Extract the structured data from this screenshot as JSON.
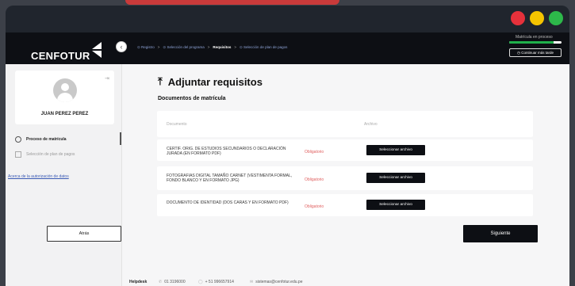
{
  "window": {
    "colors": {
      "close": "#e6313b",
      "minimize": "#f5c400",
      "maximize": "#2db84a",
      "accent": "#20b04b",
      "required": "#e06060"
    }
  },
  "sidebar": {
    "logo": "CENFOTUR",
    "collapse_icon": "chevron-left-icon",
    "user_name": "JUAN PEREZ PEREZ",
    "items": [
      {
        "label": "Proceso de matrícula",
        "icon": "circle-icon"
      },
      {
        "label": "Selección de plan de pagos",
        "icon": "calendar-icon"
      }
    ],
    "link": "Acerca de la autorización de datos"
  },
  "header": {
    "breadcrumb": [
      {
        "label": "⊙ Registro"
      },
      {
        "label": "⊙ Selección del programa"
      },
      {
        "label": "Requisitos"
      },
      {
        "label": "⊙ Selección de plan de pagos"
      }
    ],
    "progress_label": "Matrícula en proceso",
    "progress_value": 0.85,
    "continue_label": "Continuar más tarde"
  },
  "main": {
    "title": "Adjuntar requisitos",
    "section_title": "Documentos de matrícula",
    "table": {
      "columns": [
        "Documento",
        "Archivo"
      ],
      "rows": [
        {
          "document": "CERTIF. ORIG. DE ESTUDIOS SECUNDARIOS O DECLARACIÓN JURADA (EN FORMATO PDF)",
          "status": "Obligatorio",
          "action": "Seleccionar archivo"
        },
        {
          "document": "FOTOGRAFIAS DIGITAL TAMAÑO CARNET (VESTIMENTA FORMAL, FONDO BLANCO Y EN FORMATO JPG)",
          "status": "Obligatorio",
          "action": "Seleccionar archivo"
        },
        {
          "document": "DOCUMENTO DE IDENTIDAD (DOS CARAS Y EN FORMATO PDF)",
          "status": "Obligatorio",
          "action": "Seleccionar archivo"
        }
      ]
    },
    "back_label": "Atrás",
    "next_label": "Siguiente"
  },
  "footer": {
    "helpdesk": "Helpdesk",
    "phone": "01 3196000",
    "whatsapp": "+ 51 996657914",
    "email": "sistemas@cenfotur.edu.pe"
  }
}
